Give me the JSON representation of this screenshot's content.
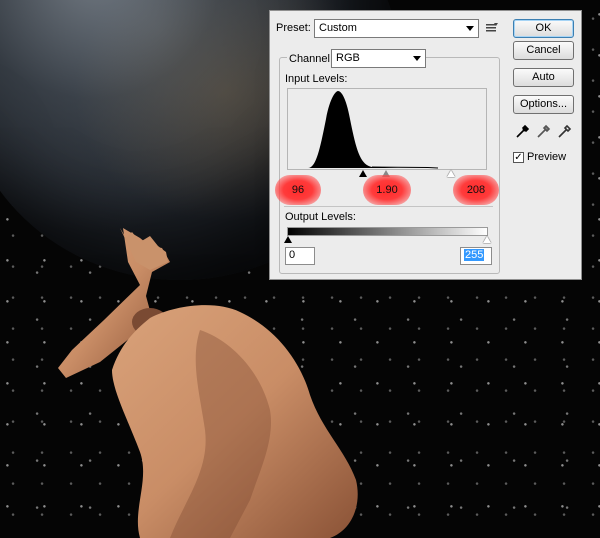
{
  "dialog": {
    "preset_label": "Preset:",
    "preset_value": "Custom",
    "channel_label": "Channel:",
    "channel_value": "RGB",
    "input_levels_label": "Input Levels:",
    "input_black": "96",
    "input_gamma": "1.90",
    "input_white": "208",
    "output_levels_label": "Output Levels:",
    "output_black": "0",
    "output_white": "255",
    "buttons": {
      "ok": "OK",
      "cancel": "Cancel",
      "auto": "Auto",
      "options": "Options..."
    },
    "preview_label": "Preview",
    "preview_checked": true
  },
  "colors": {
    "highlight": "#ff3030",
    "dialog_bg": "#ececec",
    "selection": "#3399ff"
  },
  "icons": [
    "preset-menu-icon",
    "black-eyedropper-icon",
    "gray-eyedropper-icon",
    "white-eyedropper-icon"
  ]
}
